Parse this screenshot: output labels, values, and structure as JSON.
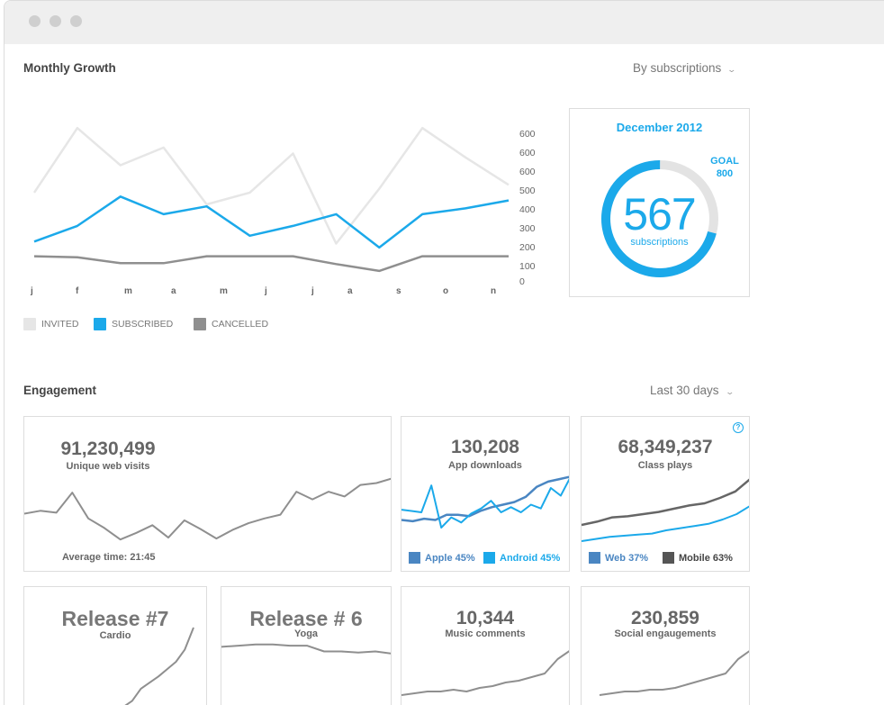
{
  "colors": {
    "invited": "#e6e6e6",
    "subscribed": "#1ba9ea",
    "cancelled": "#8f8f8f",
    "apple": "#4a86c2",
    "android": "#1ba9ea",
    "web": "#4a86c2",
    "mobile": "#555555"
  },
  "monthly_growth": {
    "title": "Monthly Growth",
    "dropdown": "By subscriptions",
    "y_ticks": [
      "600",
      "600",
      "600",
      "500",
      "400",
      "300",
      "200",
      "100",
      "0"
    ],
    "months": [
      "j",
      "f",
      "m",
      "a",
      "m",
      "j",
      "j",
      "a",
      "s",
      "o",
      "n"
    ],
    "legend": [
      {
        "label": "INVITED",
        "color": "#e6e6e6"
      },
      {
        "label": "SUBSCRIBED",
        "color": "#1ba9ea"
      },
      {
        "label": "CANCELLED",
        "color": "#8f8f8f"
      }
    ]
  },
  "chart_data": [
    {
      "type": "line",
      "title": "Monthly Growth",
      "categories": [
        "j",
        "f",
        "m",
        "a",
        "m",
        "j",
        "j",
        "a",
        "s",
        "o",
        "n"
      ],
      "y_tick_labels": [
        "600",
        "600",
        "600",
        "500",
        "400",
        "300",
        "200",
        "100",
        "0"
      ],
      "ylim": [
        0,
        800
      ],
      "legend_position": "bottom-left",
      "grid": false,
      "series": [
        {
          "name": "INVITED",
          "values": [
            460,
            790,
            600,
            690,
            400,
            460,
            660,
            200,
            480,
            790,
            640,
            500
          ]
        },
        {
          "name": "SUBSCRIBED",
          "values": [
            210,
            290,
            440,
            350,
            390,
            240,
            290,
            350,
            180,
            350,
            380,
            420
          ]
        },
        {
          "name": "CANCELLED",
          "values": [
            135,
            130,
            100,
            100,
            135,
            135,
            135,
            95,
            60,
            135,
            135,
            135
          ]
        }
      ]
    },
    {
      "type": "line",
      "title": "Unique web visits",
      "values": [
        40,
        43,
        41,
        62,
        35,
        25,
        13,
        20,
        28,
        15,
        33,
        24,
        14,
        23,
        30,
        35,
        39,
        63,
        55,
        63,
        58,
        70,
        72,
        77
      ]
    },
    {
      "type": "line",
      "title": "App downloads",
      "series": [
        {
          "name": "Apple",
          "values": [
            18,
            17,
            19,
            18,
            22,
            22,
            21,
            25,
            28,
            30,
            32,
            36,
            44,
            48,
            50,
            52
          ]
        },
        {
          "name": "Android",
          "values": [
            26,
            25,
            24,
            45,
            12,
            20,
            16,
            23,
            27,
            33,
            24,
            28,
            24,
            30,
            27,
            43,
            37,
            52
          ]
        }
      ]
    },
    {
      "type": "line",
      "title": "Class plays",
      "series": [
        {
          "name": "Web",
          "values": [
            10,
            12,
            14,
            15,
            16,
            17,
            20,
            22,
            24,
            26,
            30,
            35,
            43
          ]
        },
        {
          "name": "Mobile",
          "values": [
            25,
            28,
            32,
            33,
            35,
            37,
            40,
            43,
            45,
            50,
            56,
            68
          ]
        }
      ]
    },
    {
      "type": "line",
      "title": "Release #7",
      "values": [
        5,
        10,
        20,
        25,
        30,
        36,
        42,
        52,
        70
      ]
    },
    {
      "type": "line",
      "title": "Release # 6",
      "values": [
        50,
        51,
        52,
        52,
        51,
        51,
        46,
        46,
        45,
        46,
        44
      ]
    },
    {
      "type": "line",
      "title": "Music comments",
      "values": [
        10,
        11,
        12,
        12,
        13,
        12,
        14,
        15,
        17,
        18,
        20,
        22,
        30,
        35
      ]
    },
    {
      "type": "line",
      "title": "Social engaugements",
      "values": [
        10,
        11,
        12,
        12,
        13,
        13,
        14,
        16,
        18,
        20,
        22,
        30,
        35
      ]
    }
  ],
  "goal_card": {
    "month": "December 2012",
    "goal_label": "GOAL",
    "goal_value": "800",
    "value": "567",
    "unit": "subscriptions",
    "progress": 0.709
  },
  "engagement": {
    "title": "Engagement",
    "dropdown": "Last 30 days",
    "web_visits": {
      "value": "91,230,499",
      "label": "Unique web visits",
      "footer": "Average time: 21:45"
    },
    "app_downloads": {
      "value": "130,208",
      "label": "App downloads",
      "legend": [
        {
          "label": "Apple 45%"
        },
        {
          "label": "Android 45%"
        }
      ]
    },
    "class_plays": {
      "value": "68,349,237",
      "label": "Class plays",
      "help": "?",
      "legend": [
        {
          "label": "Web 37%"
        },
        {
          "label": "Mobile 63%"
        }
      ]
    },
    "release7": {
      "value": "Release #7",
      "label": "Cardio"
    },
    "release6": {
      "value": "Release # 6",
      "label": "Yoga"
    },
    "music": {
      "value": "10,344",
      "label": "Music comments"
    },
    "social": {
      "value": "230,859",
      "label": "Social engaugements"
    }
  }
}
